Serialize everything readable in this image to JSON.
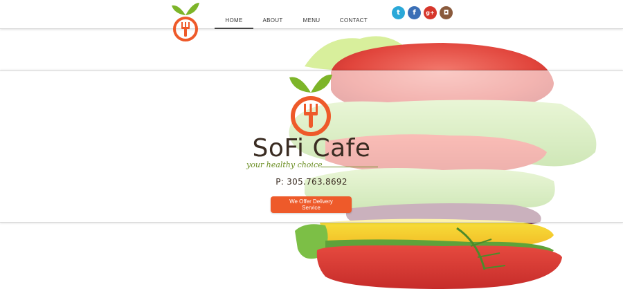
{
  "nav": {
    "items": [
      {
        "label": "HOME",
        "active": true
      },
      {
        "label": "ABOUT",
        "active": false
      },
      {
        "label": "MENU",
        "active": false
      },
      {
        "label": "CONTACT",
        "active": false
      }
    ]
  },
  "social": [
    {
      "icon": "twitter-icon",
      "glyph": "t",
      "color": "#2aa8d8"
    },
    {
      "icon": "facebook-icon",
      "glyph": "f",
      "color": "#3b6fb6"
    },
    {
      "icon": "google-plus-icon",
      "glyph": "g+",
      "color": "#d6362b"
    },
    {
      "icon": "instagram-icon",
      "glyph": "◘",
      "color": "#8a5a3c"
    }
  ],
  "brand": {
    "name": "SoFi Cafe",
    "tagline": "your healthy choice",
    "phone": "P: 305.763.8692",
    "logo_icon": "apple-fork-logo-icon"
  },
  "cta": {
    "label": "We Offer Delivery Service"
  },
  "colors": {
    "accent_orange": "#ee5a2a",
    "leaf_green": "#7db529",
    "brand_brown": "#3a2c22",
    "tagline_green": "#6b8e23"
  }
}
